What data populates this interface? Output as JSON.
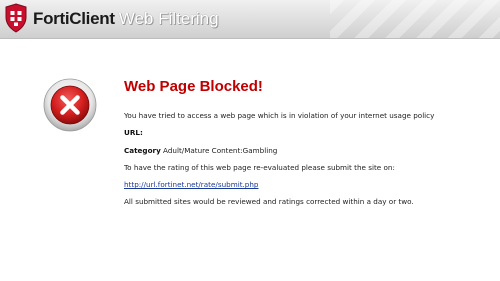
{
  "header": {
    "brand": "FortiClient",
    "product": "Web Filtering",
    "logo_icon": "forticlient-shield-icon",
    "brand_color": "#c8102e"
  },
  "alert": {
    "icon": "error-x-icon",
    "icon_color": "#d41f1f",
    "title": "Web Page Blocked!",
    "title_color": "#c00000",
    "message": "You have tried to access a web page which is in violation of your internet usage policy",
    "url_label": "URL:",
    "url_value": "",
    "category_label": "Category",
    "category_value": "Adult/Mature Content:Gambling",
    "rerate_text": "To have the rating of this web page re-evaluated please submit the site on:",
    "rerate_link": "http://url.fortinet.net/rate/submit.php",
    "footer_text": "All submitted sites would be reviewed and ratings corrected within a day or two."
  }
}
